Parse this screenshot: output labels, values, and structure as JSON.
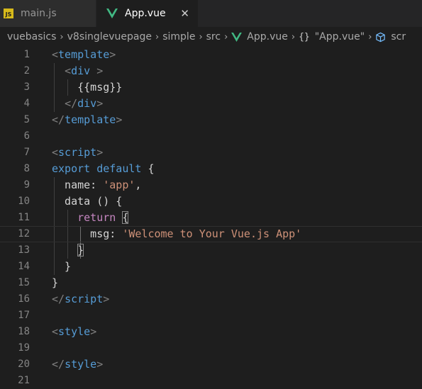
{
  "tabs": [
    {
      "label": "main.js",
      "icon": "js-icon",
      "icon_text": "JS",
      "active": false
    },
    {
      "label": "App.vue",
      "icon": "vue-icon",
      "active": true,
      "close": "✕"
    }
  ],
  "breadcrumb": {
    "items": [
      "vuebasics",
      "v8singlevuepage",
      "simple",
      "src",
      "App.vue",
      "\"App.vue\"",
      "scr"
    ],
    "separator": "›"
  },
  "colors": {
    "background": "#1e1e1e",
    "tag": "#569cd6",
    "keyword": "#569cd6",
    "control": "#c586c0",
    "property": "#9cdcfe",
    "string": "#ce9178",
    "line_number": "#858585"
  },
  "code": {
    "lines": [
      {
        "num": "1",
        "tokens": [
          [
            "t-punc",
            "<"
          ],
          [
            "t-tag",
            "template"
          ],
          [
            "t-punc",
            ">"
          ]
        ]
      },
      {
        "num": "2",
        "tokens": [
          [
            "t-plain",
            "  "
          ],
          [
            "t-punc",
            "<"
          ],
          [
            "t-tag",
            "div"
          ],
          [
            "t-plain",
            " "
          ],
          [
            "t-punc",
            ">"
          ]
        ]
      },
      {
        "num": "3",
        "tokens": [
          [
            "t-plain",
            "    {{msg}}"
          ]
        ]
      },
      {
        "num": "4",
        "tokens": [
          [
            "t-plain",
            "  "
          ],
          [
            "t-punc",
            "</"
          ],
          [
            "t-tag",
            "div"
          ],
          [
            "t-punc",
            ">"
          ]
        ]
      },
      {
        "num": "5",
        "tokens": [
          [
            "t-punc",
            "</"
          ],
          [
            "t-tag",
            "template"
          ],
          [
            "t-punc",
            ">"
          ]
        ]
      },
      {
        "num": "6",
        "tokens": []
      },
      {
        "num": "7",
        "tokens": [
          [
            "t-punc",
            "<"
          ],
          [
            "t-tag",
            "script"
          ],
          [
            "t-punc",
            ">"
          ]
        ]
      },
      {
        "num": "8",
        "tokens": [
          [
            "t-kw",
            "export"
          ],
          [
            "t-plain",
            " "
          ],
          [
            "t-kw",
            "default"
          ],
          [
            "t-plain",
            " {"
          ]
        ]
      },
      {
        "num": "9",
        "tokens": [
          [
            "t-plain",
            "  name: "
          ],
          [
            "t-str",
            "'app'"
          ],
          [
            "t-plain",
            ","
          ]
        ]
      },
      {
        "num": "10",
        "tokens": [
          [
            "t-plain",
            "  data () {"
          ]
        ]
      },
      {
        "num": "11",
        "tokens": [
          [
            "t-plain",
            "    "
          ],
          [
            "t-ctl",
            "return"
          ],
          [
            "t-plain",
            " "
          ],
          [
            "t-plain bracket-match",
            "{"
          ]
        ]
      },
      {
        "num": "12",
        "tokens": [
          [
            "t-plain",
            "      msg: "
          ],
          [
            "t-str",
            "'Welcome to Your Vue.js App'"
          ]
        ]
      },
      {
        "num": "13",
        "tokens": [
          [
            "t-plain",
            "    "
          ],
          [
            "t-plain bracket-match",
            "}"
          ]
        ]
      },
      {
        "num": "14",
        "tokens": [
          [
            "t-plain",
            "  }"
          ]
        ]
      },
      {
        "num": "15",
        "tokens": [
          [
            "t-plain",
            "}"
          ]
        ]
      },
      {
        "num": "16",
        "tokens": [
          [
            "t-punc",
            "</"
          ],
          [
            "t-tag",
            "script"
          ],
          [
            "t-punc",
            ">"
          ]
        ]
      },
      {
        "num": "17",
        "tokens": []
      },
      {
        "num": "18",
        "tokens": [
          [
            "t-punc",
            "<"
          ],
          [
            "t-tag",
            "style"
          ],
          [
            "t-punc",
            ">"
          ]
        ]
      },
      {
        "num": "19",
        "tokens": []
      },
      {
        "num": "20",
        "tokens": [
          [
            "t-punc",
            "</"
          ],
          [
            "t-tag",
            "style"
          ],
          [
            "t-punc",
            ">"
          ]
        ]
      },
      {
        "num": "21",
        "tokens": []
      }
    ]
  }
}
